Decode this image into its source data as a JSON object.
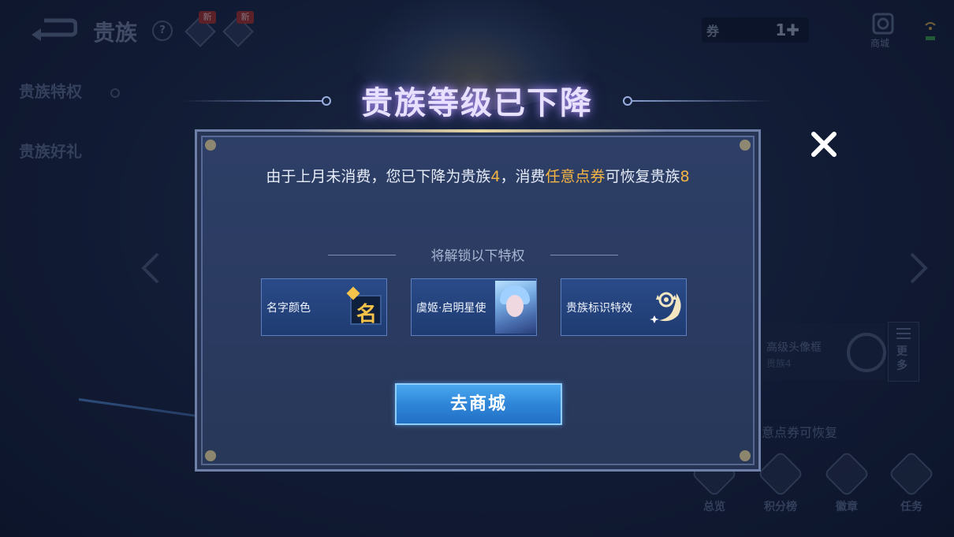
{
  "background": {
    "page_title": "贵族",
    "help_icon": "?",
    "new_badge": "新",
    "currency": {
      "value": "1"
    },
    "shop_label": "商城",
    "sidebar": [
      {
        "label": "贵族特权"
      },
      {
        "label": "贵族好礼"
      }
    ],
    "frame_card": {
      "title": "高级头像框",
      "subtitle": "贵族4"
    },
    "more_label": "更多",
    "restore_tag": "意点券可恢复",
    "bottom_nav": [
      {
        "label": "总览"
      },
      {
        "label": "积分榜"
      },
      {
        "label": "徽章"
      },
      {
        "label": "任务"
      }
    ]
  },
  "modal": {
    "title": "贵族等级已下降",
    "message": {
      "part1": "由于上月未消费，您已下降为贵族",
      "level_now": "4",
      "part2": "，消费",
      "voucher": "任意点券",
      "part3": "可恢复贵族",
      "level_restore": "8"
    },
    "section_title": "将解锁以下特权",
    "privileges": [
      {
        "label": "名字颜色",
        "badge_char": "名"
      },
      {
        "label": "虞姬·启明星使"
      },
      {
        "label": "贵族标识特效"
      }
    ],
    "button_label": "去商城"
  },
  "colors": {
    "highlight": "#f5b544",
    "button": "#2f86d8"
  }
}
